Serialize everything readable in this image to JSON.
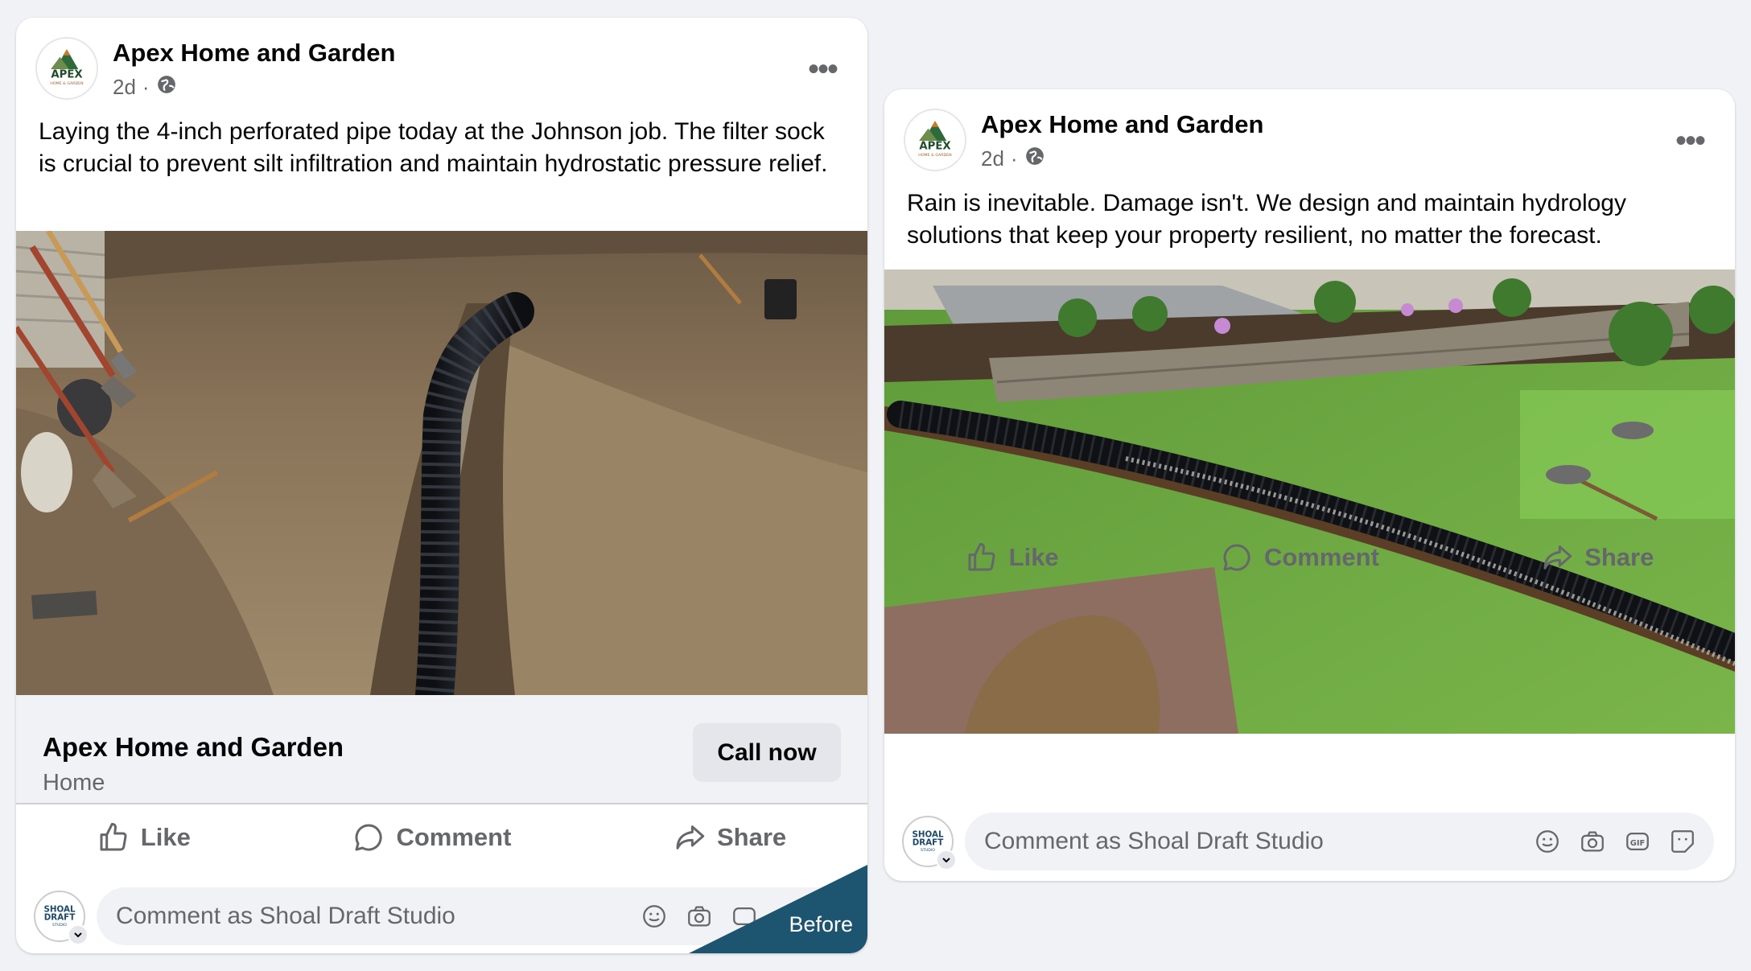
{
  "posts": [
    {
      "page_name": "Apex Home and Garden",
      "time": "2d",
      "separator": "·",
      "logo_text": "APEX",
      "logo_subtext": "HOME & GARDEN",
      "text": "Laying the 4-inch perforated pipe today at the Johnson job. The filter sock is crucial to prevent silt infiltration and maintain hydrostatic pressure relief.",
      "photo_icon": "muddy-trench-photo",
      "cta": {
        "name": "Apex Home and Garden",
        "category": "Home",
        "button": "Call now"
      },
      "actions": {
        "like": "Like",
        "comment": "Comment",
        "share": "Share"
      },
      "comment_placeholder": "Comment as Shoal Draft Studio",
      "avatar_text": [
        "SHOAL",
        "DRAFT",
        "STUDIO"
      ],
      "corner_tag": "Before"
    },
    {
      "page_name": "Apex Home and Garden",
      "time": "2d",
      "separator": "·",
      "logo_text": "APEX",
      "logo_subtext": "HOME & GARDEN",
      "text": "Rain is inevitable. Damage isn't. We design and maintain hydrology solutions that keep your property resilient, no matter the forecast.",
      "photo_icon": "landscaped-drain-photo",
      "actions": {
        "like": "Like",
        "comment": "Comment",
        "share": "Share"
      },
      "comment_placeholder": "Comment as Shoal Draft Studio",
      "avatar_text": [
        "SHOAL",
        "DRAFT",
        "STUDIO"
      ]
    }
  ],
  "colors": {
    "brand_green": "#2f6b3a",
    "tag_blue": "#1d5470",
    "muted": "#65676b"
  }
}
